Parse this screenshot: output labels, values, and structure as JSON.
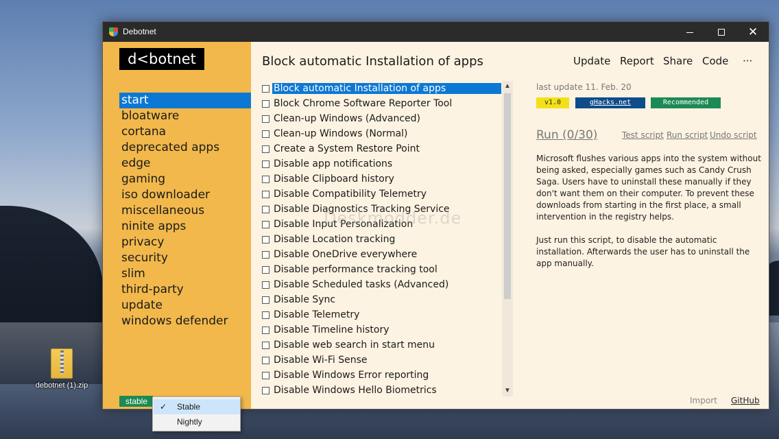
{
  "desktop": {
    "icon_label": "debotnet (1).zip"
  },
  "window": {
    "title": "Debotnet",
    "controls": {
      "minimize": "minimize",
      "maximize": "maximize",
      "close": "✕"
    }
  },
  "sidebar": {
    "logo": "d<botnet",
    "categories": [
      "start",
      "bloatware",
      "cortana",
      "deprecated apps",
      "edge",
      "gaming",
      "iso downloader",
      "miscellaneous",
      "ninite apps",
      "privacy",
      "security",
      "slim",
      "third-party",
      "update",
      "windows defender"
    ],
    "active_index": 0,
    "channel": "stable"
  },
  "main": {
    "title": "Block automatic Installation of apps",
    "nav": [
      "Update",
      "Report",
      "Share",
      "Code",
      "···"
    ],
    "scripts": [
      "Block automatic Installation of apps",
      "Block Chrome Software Reporter Tool",
      "Clean-up Windows (Advanced)",
      "Clean-up Windows (Normal)",
      "Create a System Restore Point",
      "Disable app notifications",
      "Disable Clipboard history",
      "Disable Compatibility Telemetry",
      "Disable Diagnostics Tracking Service",
      "Disable Input Personalization",
      "Disable Location tracking",
      "Disable OneDrive everywhere",
      "Disable performance tracking tool",
      "Disable Scheduled tasks (Advanced)",
      "Disable Sync",
      "Disable Telemetry",
      "Disable Timeline history",
      "Disable web search in start menu",
      "Disable Wi-Fi Sense",
      "Disable Windows Error reporting",
      "Disable Windows Hello Biometrics"
    ],
    "selected_index": 0,
    "watermark": "Deskmodder.de"
  },
  "info": {
    "last_update": "last update 11. Feb. 20",
    "tags": {
      "version": "v1.0",
      "source": "gHacks.net",
      "status": "Recommended"
    },
    "run": "Run (0/30)",
    "links": {
      "test": "Test script",
      "run": "Run script",
      "undo": "Undo script"
    },
    "description": [
      "Microsoft flushes various apps into the system without being asked, especially games such as Candy Crush Saga. Users have to uninstall these manually if they don't want them on their computer. To prevent these downloads from starting in the first place, a small intervention in the registry helps.",
      "Just run this script, to disable the automatic installation. Afterwards the user has to uninstall the app manually."
    ],
    "import": "Import",
    "github": "GitHub"
  },
  "popup": {
    "items": [
      "Stable",
      "Nightly"
    ],
    "checked_index": 0,
    "check_glyph": "✓"
  },
  "colors": {
    "sidebar": "#f2b84b",
    "accent": "#0d78d4",
    "content_bg": "#fdf3e2",
    "titlebar": "#2b2b2b",
    "tag_version": "#f4e019",
    "tag_source": "#0f4c8a",
    "tag_status": "#1c8a54"
  }
}
